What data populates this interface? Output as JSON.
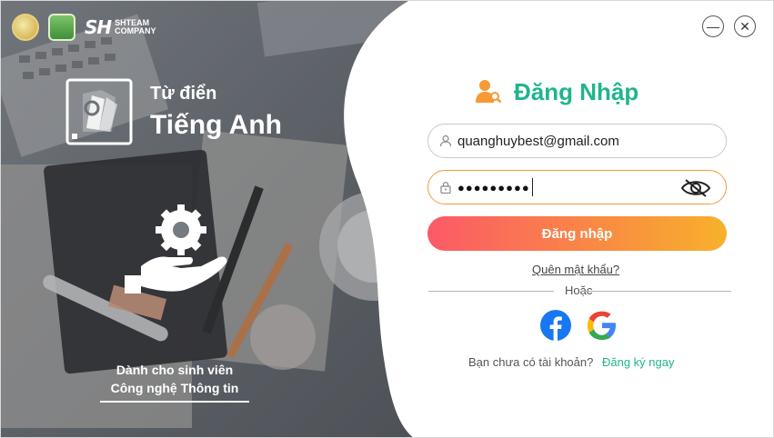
{
  "brand": {
    "logos": [
      "school-logo-icon",
      "faculty-logo-icon"
    ],
    "company_mark": "SH",
    "company_name_line1": "SHTEAM",
    "company_name_line2": "COMPANY",
    "company_team": "TEAM"
  },
  "app": {
    "title_line1": "Từ điển",
    "title_line2": "Tiếng Anh",
    "tagline_line1": "Dành cho sinh viên",
    "tagline_line2": "Công nghệ Thông tin"
  },
  "window_controls": {
    "minimize_glyph": "—",
    "close_glyph": "✕"
  },
  "login": {
    "title": "Đăng Nhập",
    "email_value": "quanghuybest@gmail.com",
    "password_value": "●●●●●●●●●",
    "submit_label": "Đăng nhập",
    "forgot_label": "Quên mật khẩu?",
    "or_label": "Hoặc",
    "no_account_label": "Bạn chưa có tài khoản?",
    "signup_label": "Đăng ký ngay"
  },
  "colors": {
    "accent": "#1fb58e",
    "button_start": "#fb5a67",
    "button_end": "#f7b12b",
    "password_border": "#f39a3c"
  }
}
